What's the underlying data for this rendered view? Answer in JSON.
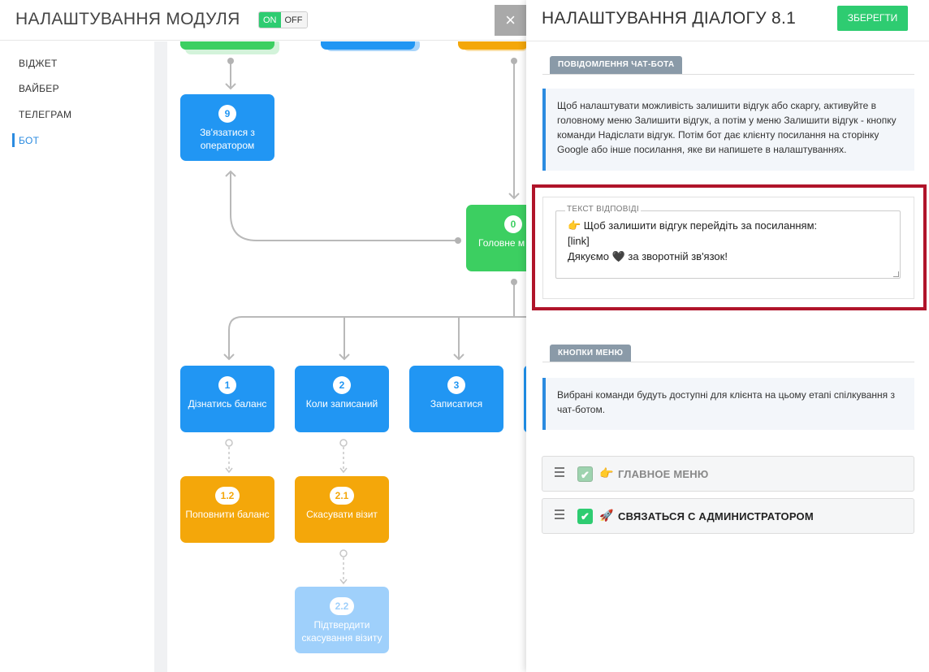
{
  "app": {
    "title": "НАЛАШТУВАННЯ МОДУЛЯ",
    "toggle_on": "ON",
    "toggle_off": "OFF",
    "close_icon": "×"
  },
  "sidebar": {
    "items": [
      {
        "label": "ВІДЖЕТ"
      },
      {
        "label": "ВАЙБЕР"
      },
      {
        "label": "ТЕЛЕГРАМ"
      },
      {
        "label": "БОТ",
        "active": true
      }
    ]
  },
  "flow": {
    "nodes": [
      {
        "num": "9",
        "label": "Зв'язатися з оператором",
        "color": "#2196f3"
      },
      {
        "num": "0",
        "label": "Головне м",
        "color": "#3ccf61"
      },
      {
        "num": "1",
        "label": "Дізнатись баланс",
        "color": "#2196f3"
      },
      {
        "num": "2",
        "label": "Коли записаний",
        "color": "#2196f3"
      },
      {
        "num": "3",
        "label": "Записатися",
        "color": "#2196f3"
      },
      {
        "num": "1.2",
        "label": "Поповнити баланс",
        "color": "#f4a70a"
      },
      {
        "num": "2.1",
        "label": "Скасувати візит",
        "color": "#f4a70a"
      },
      {
        "num": "2.2",
        "label": "Підтвердити скасування візиту",
        "color": "#9fd0fb"
      }
    ]
  },
  "panel": {
    "title": "НАЛАШТУВАННЯ ДІАЛОГУ 8.1",
    "save_label": "ЗБЕРЕГТИ",
    "section_message": "ПОВІДОМЛЕННЯ ЧАТ-БОТА",
    "info_text": "Щоб налаштувати можливість залишити відгук або скаргу, активуйте в головному меню Залишити відгук, а потім у меню Залишити відгук - кнопку команди Надіслати відгук. Потім бот дає клієнту посилання на сторінку Google або інше посилання, яке ви напишете в налаштуваннях.",
    "reply_legend": "ТЕКСТ ВІДПОВІДІ",
    "reply_lines": [
      "👉  Щоб залишити відгук перейдіть за посиланням:",
      "[link]",
      "Дякуємо 🖤 за зворотній зв'язок!"
    ],
    "section_menu": "КНОПКИ МЕНЮ",
    "menu_info": "Вибрані команди будуть доступні для клієнта на цьому етапі спілкування з чат-ботом.",
    "menu_items": [
      {
        "emoji": "👉",
        "label": "ГЛАВНОЕ МЕНЮ",
        "checked": true,
        "muted": true
      },
      {
        "emoji": "🚀",
        "label": "СВЯЗАТЬСЯ С АДМИНИСТРАТОРОМ",
        "checked": true,
        "muted": false
      }
    ]
  }
}
